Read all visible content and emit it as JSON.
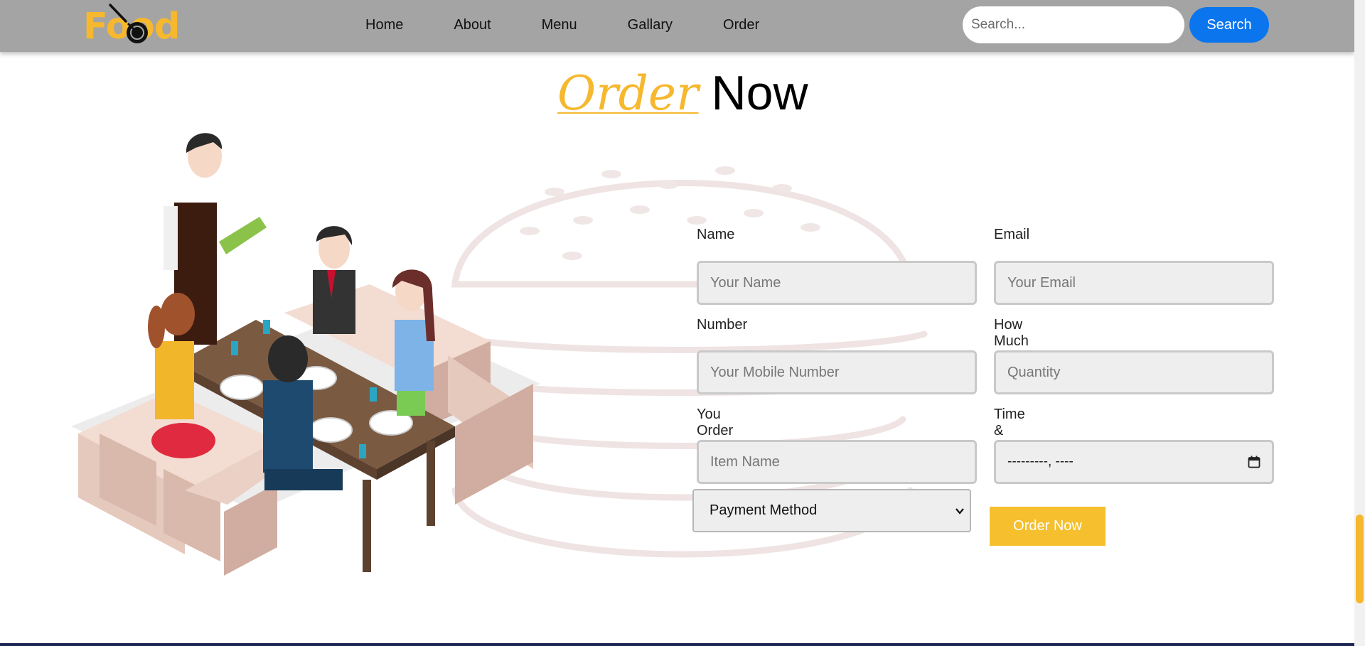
{
  "brand": {
    "logo_text": "Food",
    "accent_color": "#f5b82e"
  },
  "nav": {
    "items": [
      {
        "label": "Home"
      },
      {
        "label": "About"
      },
      {
        "label": "Menu"
      },
      {
        "label": "Gallary"
      },
      {
        "label": "Order"
      }
    ],
    "search_placeholder": "Search...",
    "search_button": "Search",
    "search_button_color": "#0b75ee"
  },
  "heading": {
    "accent": "Order",
    "rest": "Now"
  },
  "form": {
    "name": {
      "label": "Name",
      "placeholder": "Your Name"
    },
    "email": {
      "label": "Email",
      "placeholder": "Your Email"
    },
    "number": {
      "label": "Number",
      "placeholder": "Your Mobile Number"
    },
    "how_much": {
      "label": "How Much",
      "placeholder": "Quantity"
    },
    "you_order": {
      "label": "You Order",
      "placeholder": "Item Name"
    },
    "time_date": {
      "label": "Time & Date",
      "value": "---------, ----"
    },
    "payment_method": {
      "selected": "Payment Method"
    },
    "submit_label": "Order Now",
    "submit_color": "#f5bf2e"
  },
  "icons": {
    "logo": "fork-and-spoon-icon",
    "calendar": "calendar-icon",
    "dropdown": "chevron-down-icon"
  }
}
